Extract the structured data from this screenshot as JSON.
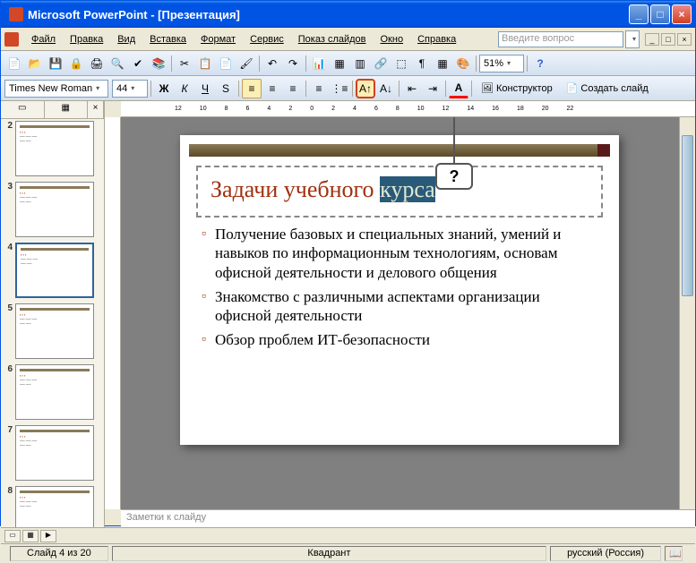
{
  "title": "Microsoft PowerPoint - [Презентация]",
  "menu": [
    "Файл",
    "Правка",
    "Вид",
    "Вставка",
    "Формат",
    "Сервис",
    "Показ слайдов",
    "Окно",
    "Справка"
  ],
  "ask_placeholder": "Введите вопрос",
  "font_name": "Times New Roman",
  "font_size": "44",
  "zoom": "51%",
  "fmt": {
    "bold": "Ж",
    "italic": "К",
    "underline": "Ч",
    "shadow": "S"
  },
  "design_btn": "Конструктор",
  "new_slide_btn": "Создать слайд",
  "callout_label": "?",
  "slide": {
    "title_plain": "Задачи учебного ",
    "title_selected": "курса",
    "bullets": [
      "Получение базовых и специальных знаний, умений и навыков по информационным технологиям, основам офисной деятельности и делового общения",
      "Знакомство с различными аспектами организации офисной деятельности",
      "Обзор проблем ИТ-безопасности"
    ]
  },
  "notes_placeholder": "Заметки к слайду",
  "thumbs": [
    2,
    3,
    4,
    5,
    6,
    7,
    8
  ],
  "selected_thumb": 4,
  "status": {
    "slide": "Слайд 4 из 20",
    "section": "Квадрант",
    "lang": "русский (Россия)"
  },
  "ruler_marks": [
    "12",
    "10",
    "8",
    "6",
    "4",
    "2",
    "0",
    "2",
    "4",
    "6",
    "8",
    "10",
    "12",
    "14",
    "16",
    "18",
    "20",
    "22"
  ]
}
